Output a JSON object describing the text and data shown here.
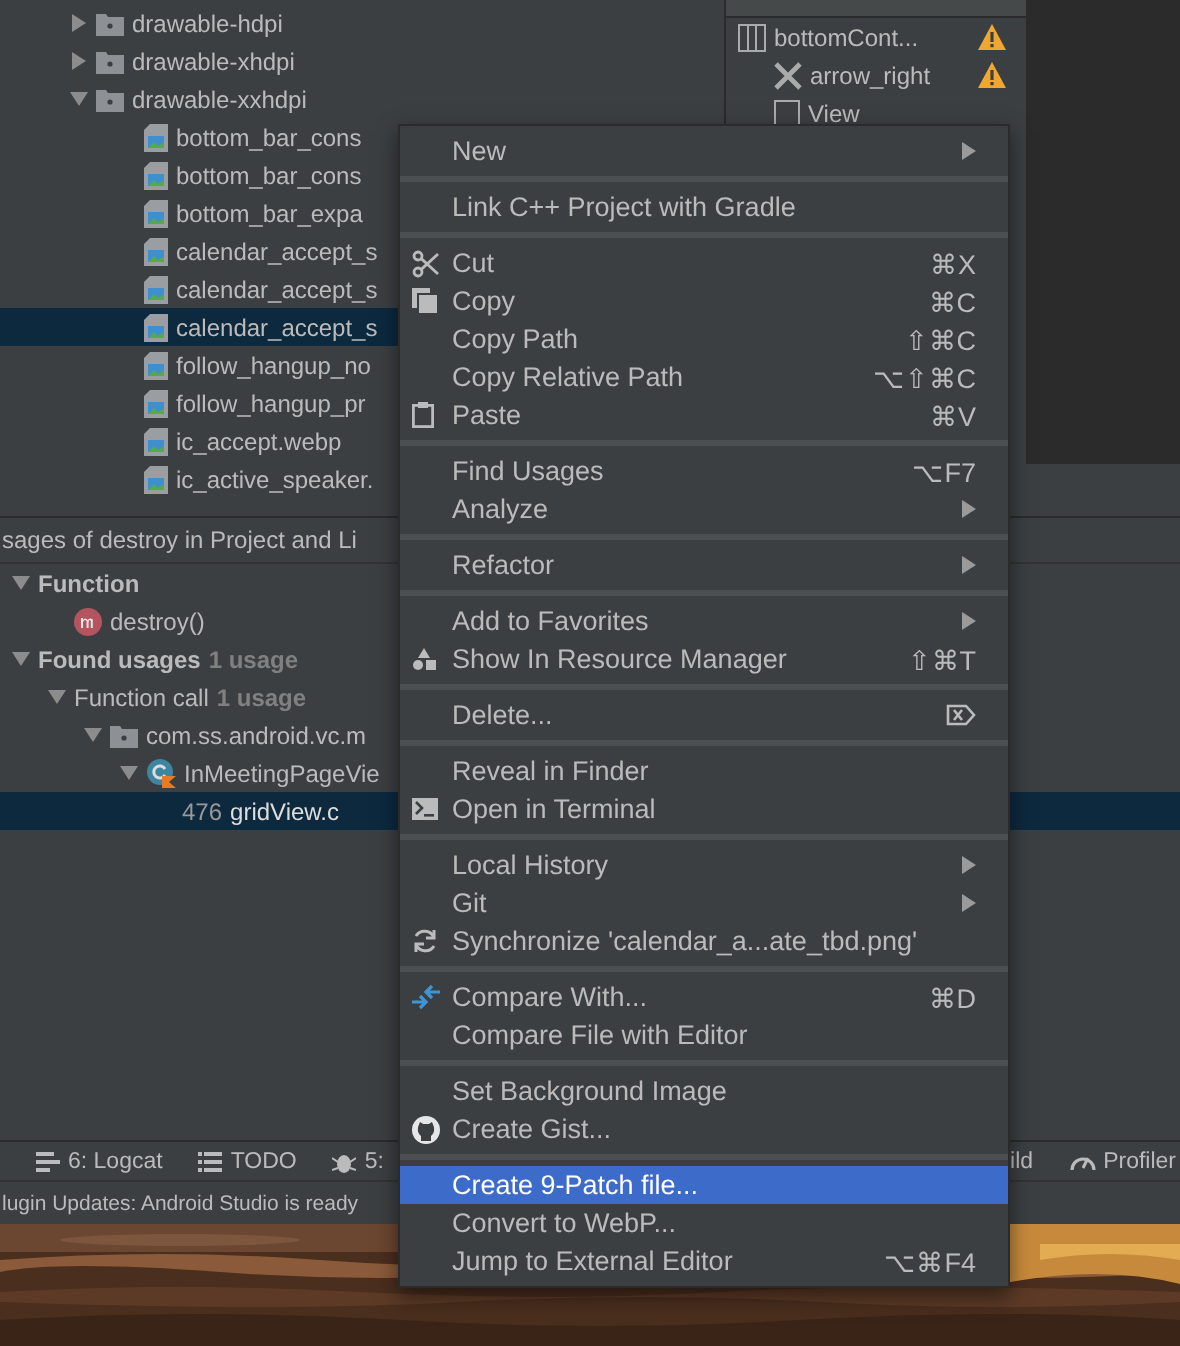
{
  "project_tree": [
    {
      "label": "drawable-hdpi",
      "expanded": false
    },
    {
      "label": "drawable-xhdpi",
      "expanded": false
    },
    {
      "label": "drawable-xxhdpi",
      "expanded": true,
      "children": [
        {
          "label": "bottom_bar_cons",
          "selected": false
        },
        {
          "label": "bottom_bar_cons",
          "selected": false
        },
        {
          "label": "bottom_bar_expa",
          "selected": false
        },
        {
          "label": "calendar_accept_s",
          "selected": false
        },
        {
          "label": "calendar_accept_s",
          "selected": false
        },
        {
          "label": "calendar_accept_s",
          "selected": true
        },
        {
          "label": "follow_hangup_no",
          "selected": false
        },
        {
          "label": "follow_hangup_pr",
          "selected": false
        },
        {
          "label": "ic_accept.webp",
          "selected": false
        },
        {
          "label": "ic_active_speaker.",
          "selected": false
        }
      ]
    }
  ],
  "component_tree": [
    {
      "label": "bottomCont...",
      "warning": true,
      "children": [
        {
          "label": "arrow_right",
          "warning": true
        },
        {
          "label": "View",
          "warning": false
        }
      ]
    }
  ],
  "usages": {
    "title": "sages of destroy in Project and Li",
    "tree": [
      {
        "label": "Function",
        "bold": true,
        "expanded": true,
        "children": [
          {
            "label": "destroy()",
            "kind": "method"
          }
        ]
      },
      {
        "label": "Found usages",
        "bold": true,
        "count": "1 usage",
        "expanded": true,
        "children": [
          {
            "label": "Function call",
            "bold": false,
            "count": "1 usage",
            "expanded": true,
            "children": [
              {
                "label": "com.ss.android.vc.m",
                "kind": "package",
                "expanded": true,
                "children": [
                  {
                    "label": "InMeetingPageVie",
                    "kind": "class",
                    "expanded": true,
                    "children": [
                      {
                        "label": "gridView.c",
                        "kind": "line",
                        "line_number": "476",
                        "selected": true
                      }
                    ]
                  }
                ]
              }
            ]
          }
        ]
      }
    ]
  },
  "toolbar": [
    {
      "label": "6: Logcat",
      "kind": "logcat"
    },
    {
      "label": "TODO",
      "kind": "todo"
    },
    {
      "label": "5:",
      "kind": "debug"
    }
  ],
  "toolbar_right": [
    {
      "label": "ild",
      "kind": "none"
    },
    {
      "label": "Profiler",
      "kind": "profiler"
    }
  ],
  "status_bar": "lugin Updates: Android Studio is ready",
  "menu": [
    [
      {
        "label": "New",
        "submenu": true,
        "selected": false
      }
    ],
    [
      {
        "label": "Link C++ Project with Gradle",
        "submenu": false,
        "selected": false
      }
    ],
    [
      {
        "label": "Cut",
        "shortcut": "⌘X",
        "submenu": false,
        "selected": false
      },
      {
        "label": "Copy",
        "shortcut": "⌘C",
        "submenu": false,
        "selected": false
      },
      {
        "label": "Copy Path",
        "shortcut": "⇧⌘C",
        "submenu": false,
        "selected": false
      },
      {
        "label": "Copy Relative Path",
        "shortcut": "⌥⇧⌘C",
        "submenu": false,
        "selected": false
      },
      {
        "label": "Paste",
        "shortcut": "⌘V",
        "submenu": false,
        "selected": false
      }
    ],
    [
      {
        "label": "Find Usages",
        "shortcut": "⌥F7",
        "submenu": false,
        "selected": false
      },
      {
        "label": "Analyze",
        "submenu": true,
        "selected": false
      }
    ],
    [
      {
        "label": "Refactor",
        "submenu": true,
        "selected": false
      }
    ],
    [
      {
        "label": "Add to Favorites",
        "submenu": true,
        "selected": false
      },
      {
        "label": "Show In Resource Manager",
        "shortcut": "⇧⌘T",
        "submenu": false,
        "selected": false
      }
    ],
    [
      {
        "label": "Delete...",
        "submenu": false,
        "selected": false,
        "kind": "delete"
      }
    ],
    [
      {
        "label": "Reveal in Finder",
        "submenu": false,
        "selected": false
      },
      {
        "label": "Open in Terminal",
        "submenu": false,
        "selected": false
      }
    ],
    [
      {
        "label": "Local History",
        "submenu": true,
        "selected": false
      },
      {
        "label": "Git",
        "submenu": true,
        "selected": false
      },
      {
        "label": "Synchronize 'calendar_a...ate_tbd.png'",
        "submenu": false,
        "selected": false
      }
    ],
    [
      {
        "label": "Compare With...",
        "shortcut": "⌘D",
        "submenu": false,
        "selected": false
      },
      {
        "label": "Compare File with Editor",
        "submenu": false,
        "selected": false
      }
    ],
    [
      {
        "label": "Set Background Image",
        "submenu": false,
        "selected": false
      },
      {
        "label": "Create Gist...",
        "submenu": false,
        "selected": false
      }
    ],
    [
      {
        "label": "Create 9-Patch file...",
        "submenu": false,
        "selected": true
      },
      {
        "label": "Convert to WebP...",
        "submenu": false,
        "selected": false
      },
      {
        "label": "Jump to External Editor",
        "shortcut": "⌥⌘F4",
        "submenu": false,
        "selected": false
      }
    ]
  ]
}
